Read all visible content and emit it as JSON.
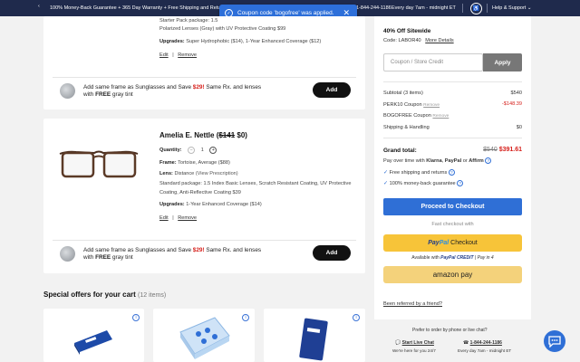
{
  "topbar": {
    "promo": "100% Money-Back Guarantee + 365 Day Warranty + Free Shipping and Retu",
    "phone": "1-844-244-1186",
    "hours": "Every day 7am - midnight ET",
    "help": "Help & Support",
    "bg_color": "#1f2a4c"
  },
  "toast": {
    "message": "Coupon code 'bogofree' was applied."
  },
  "item1": {
    "package": "Starter Pack package: 1.5",
    "lens_line": "Polarized Lenses (Gray) with UV Protective Coating $99",
    "upgrades_label": "Upgrades:",
    "upgrades_value": "Super Hydrophobic ($14), 1-Year Enhanced Coverage ($12)",
    "edit": "Edit",
    "sep": "|",
    "remove": "Remove"
  },
  "sun_offer": {
    "text_a": "Add same frame as Sunglasses and Save ",
    "price": "$29!",
    "text_b": " Same Rx. and lenses",
    "text_c": "with ",
    "free": "FREE",
    "text_d": " gray tint",
    "add": "Add"
  },
  "item2": {
    "name": "Amelia E. Nettle",
    "old_price": "$141",
    "new_price": "$0",
    "quantity_label": "Quantity:",
    "minus": "−",
    "quantity": "1",
    "plus": "+",
    "frame_label": "Frame:",
    "frame_value": "Tortoise, Average ($88)",
    "lens_label": "Lens:",
    "lens_value": "Distance",
    "view_rx": "(View Prescription)",
    "package_1": "Standard package: 1.5 Index Basic Lenses, Scratch Resistant Coating, UV Protective",
    "package_2": "Coating, Anti-Reflective Coating $39",
    "upgrades_label": "Upgrades:",
    "upgrades_value": "1-Year Enhanced Coverage ($14)",
    "edit": "Edit",
    "sep": "|",
    "remove": "Remove"
  },
  "special_offers": {
    "title": "Special offers for your cart",
    "count": "(12 items)"
  },
  "summary": {
    "offer_title": "40% Off Sitewide",
    "code_label": "Code: LABOR40",
    "more_details": "More Details",
    "coupon_placeholder": "Coupon / Store Credit",
    "apply": "Apply",
    "subtotal_label": "Subtotal (3 items)",
    "subtotal_value": "$540",
    "perk_label": "PERK10 Coupon",
    "perk_remove": "Remove",
    "perk_value": "-$148.39",
    "bogo_label": "BOGOFREE Coupon",
    "bogo_remove": "Remove",
    "shipping_label": "Shipping & Handling",
    "shipping_value": "$0",
    "grand_label": "Grand total:",
    "grand_old": "$540",
    "grand_new": "$391.61",
    "pay_over": "Pay over time with",
    "klarna": "Klarna",
    "paypal_word": "PayPal",
    "or": "or",
    "affirm": "Affirm",
    "free_ship": "Free shipping and returns",
    "money_back": "100% money-back guarantee",
    "checkout": "Proceed to Checkout",
    "fast_checkout": "Fast checkout with",
    "paypal_pay": "Pay",
    "paypal_pal": "Pal",
    "paypal_checkout": "Checkout",
    "paypal_available": "Available with",
    "paypal_credit": "PayPal CREDIT",
    "pay_in_4": "Pay in 4",
    "amazon_pay": "amazon pay",
    "referred": "Been referred by a friend?",
    "accent": "#2f6fd6",
    "discount_color": "#d6201b"
  },
  "footer_help": {
    "prefer": "Prefer to order by phone or live chat?",
    "live_chat": "Start Live Chat",
    "live_chat_sub": "We're here for you 24/7",
    "phone": "1-844-244-1186",
    "phone_sub": "Every day 7am - midnight ET"
  }
}
